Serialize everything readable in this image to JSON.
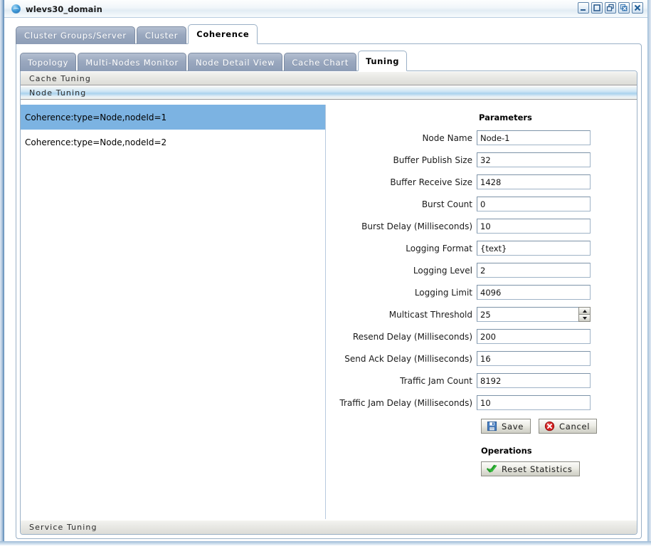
{
  "window": {
    "title": "wlevs30_domain",
    "icon": "globe-icon",
    "controls": [
      {
        "name": "minimize-button",
        "glyph": "minimize"
      },
      {
        "name": "maximize-button",
        "glyph": "maximize"
      },
      {
        "name": "restore-button",
        "glyph": "restore"
      },
      {
        "name": "close-internal-frame-button",
        "glyph": "close-small"
      },
      {
        "name": "close-window-button",
        "glyph": "close"
      }
    ]
  },
  "tabs_primary": [
    {
      "label": "Cluster Groups/Server",
      "active": false
    },
    {
      "label": "Cluster",
      "active": false
    },
    {
      "label": "Coherence",
      "active": true
    }
  ],
  "tabs_secondary": [
    {
      "label": "Topology",
      "active": false
    },
    {
      "label": "Multi-Nodes Monitor",
      "active": false
    },
    {
      "label": "Node Detail View",
      "active": false
    },
    {
      "label": "Cache Chart",
      "active": false
    },
    {
      "label": "Tuning",
      "active": true
    }
  ],
  "accordion": {
    "cache_tuning": "Cache Tuning",
    "node_tuning": "Node Tuning",
    "service_tuning": "Service Tuning"
  },
  "node_list": [
    {
      "label": "Coherence:type=Node,nodeId=1",
      "selected": true
    },
    {
      "label": "Coherence:type=Node,nodeId=2",
      "selected": false
    }
  ],
  "form": {
    "heading": "Parameters",
    "fields": [
      {
        "label": "Node Name",
        "value": "Node-1",
        "type": "text"
      },
      {
        "label": "Buffer Publish Size",
        "value": "32",
        "type": "text"
      },
      {
        "label": "Buffer Receive Size",
        "value": "1428",
        "type": "text"
      },
      {
        "label": "Burst Count",
        "value": "0",
        "type": "text"
      },
      {
        "label": "Burst Delay (Milliseconds)",
        "value": "10",
        "type": "text"
      },
      {
        "label": "Logging Format",
        "value": "{text}",
        "type": "text"
      },
      {
        "label": "Logging Level",
        "value": "2",
        "type": "text"
      },
      {
        "label": "Logging Limit",
        "value": "4096",
        "type": "text"
      },
      {
        "label": "Multicast Threshold",
        "value": "25",
        "type": "spinner"
      },
      {
        "label": "Resend Delay (Milliseconds)",
        "value": "200",
        "type": "text"
      },
      {
        "label": "Send Ack Delay (Milliseconds)",
        "value": "16",
        "type": "text"
      },
      {
        "label": "Traffic Jam Count",
        "value": "8192",
        "type": "text"
      },
      {
        "label": "Traffic Jam Delay (Milliseconds)",
        "value": "10",
        "type": "text"
      }
    ],
    "save_label": "Save",
    "cancel_label": "Cancel",
    "operations_heading": "Operations",
    "reset_statistics_label": "Reset Statistics"
  },
  "colors": {
    "selection_blue": "#7cb3e2",
    "tab_inactive": "#9aa8bf",
    "accordion_expanded": "#a9d3ee",
    "save_icon": "#3a6fb5",
    "cancel_icon": "#cf2222",
    "reset_icon": "#1f9a27"
  }
}
